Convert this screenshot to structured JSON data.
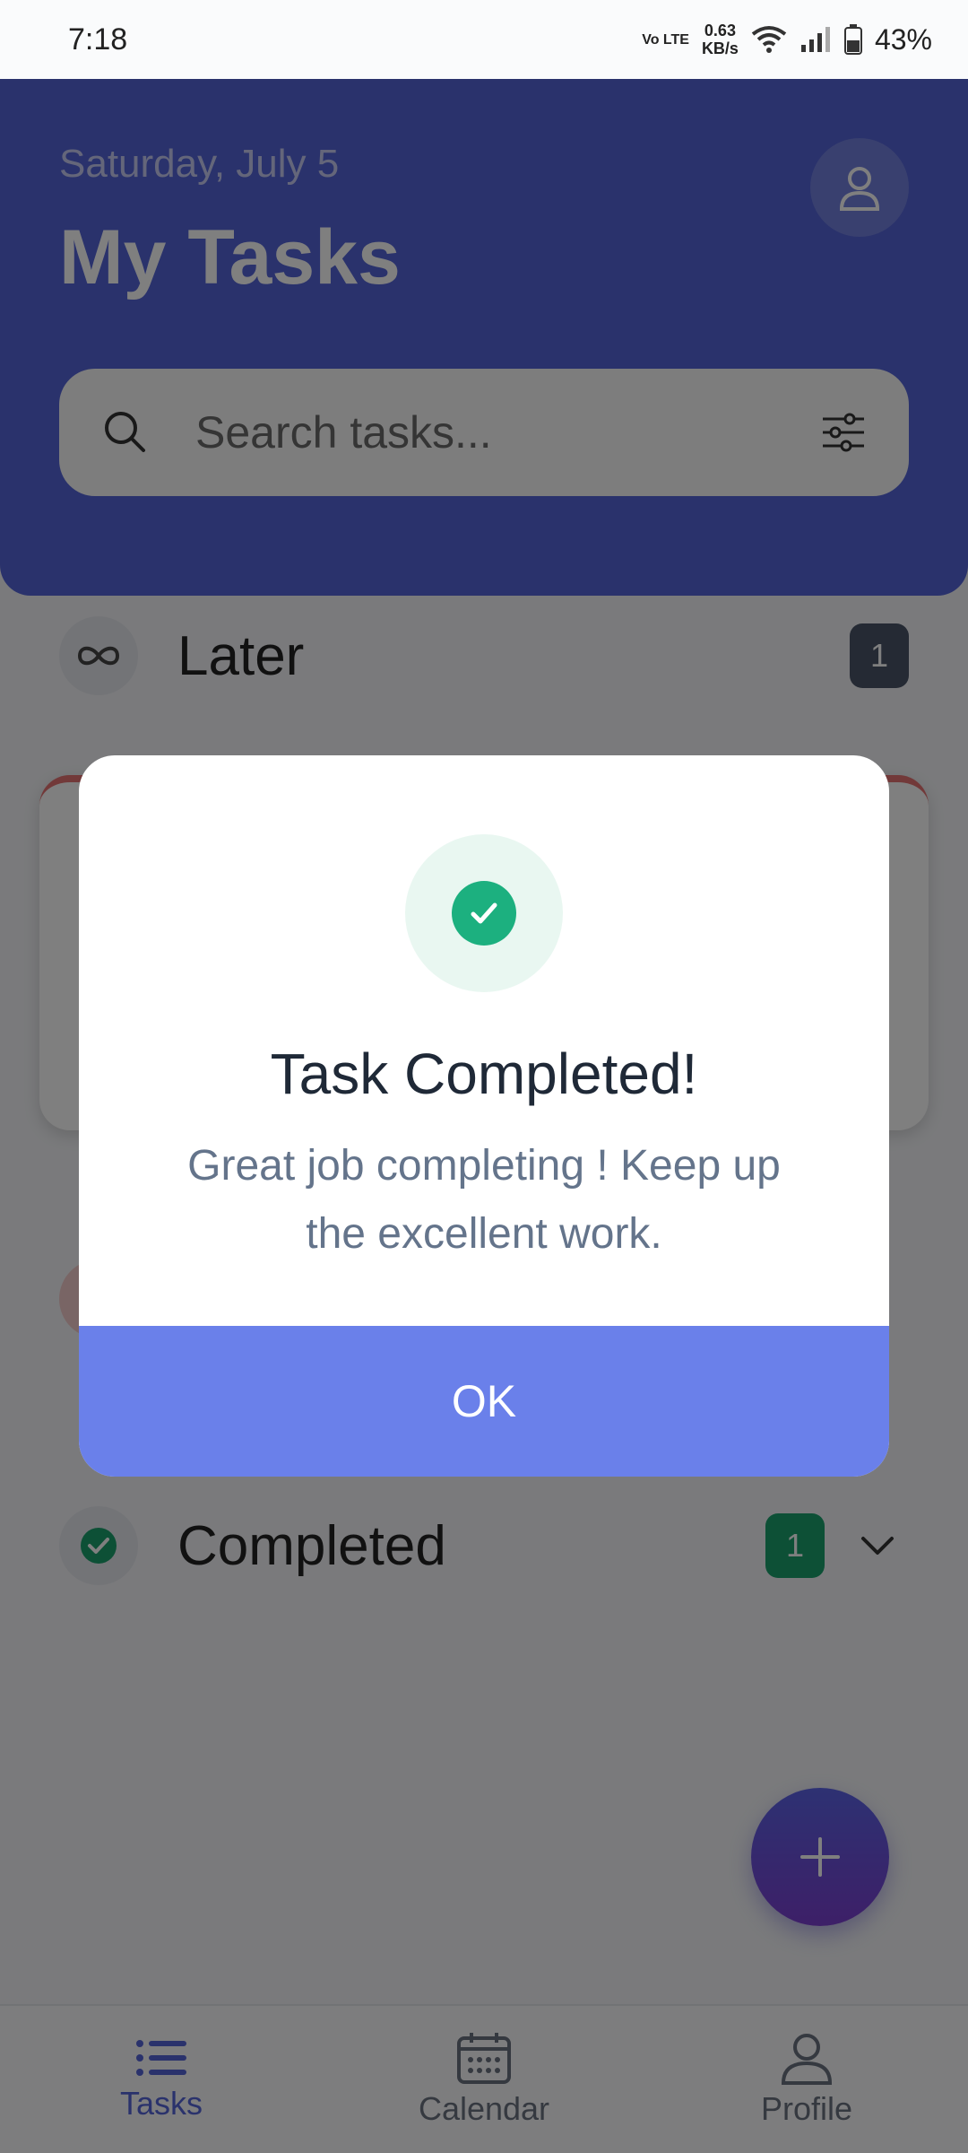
{
  "status_bar": {
    "time": "7:18",
    "volte": "Vo LTE",
    "speed_value": "0.63",
    "speed_unit": "KB/s",
    "battery": "43%"
  },
  "header": {
    "date": "Saturday, July 5",
    "title": "My Tasks",
    "search_placeholder": "Search tasks..."
  },
  "sections": {
    "later": {
      "label": "Later",
      "count": "1"
    },
    "completed": {
      "label": "Completed",
      "count": "1"
    }
  },
  "dialog": {
    "title": "Task Completed!",
    "message": "Great job completing ! Keep up the excellent work.",
    "ok_label": "OK"
  },
  "nav": {
    "tasks": "Tasks",
    "calendar": "Calendar",
    "profile": "Profile"
  },
  "colors": {
    "header": "#5565d8",
    "success": "#1cb07f",
    "ok_button": "#6a80ea",
    "badge_completed": "#1aa06d",
    "badge_later": "#4a5568"
  }
}
